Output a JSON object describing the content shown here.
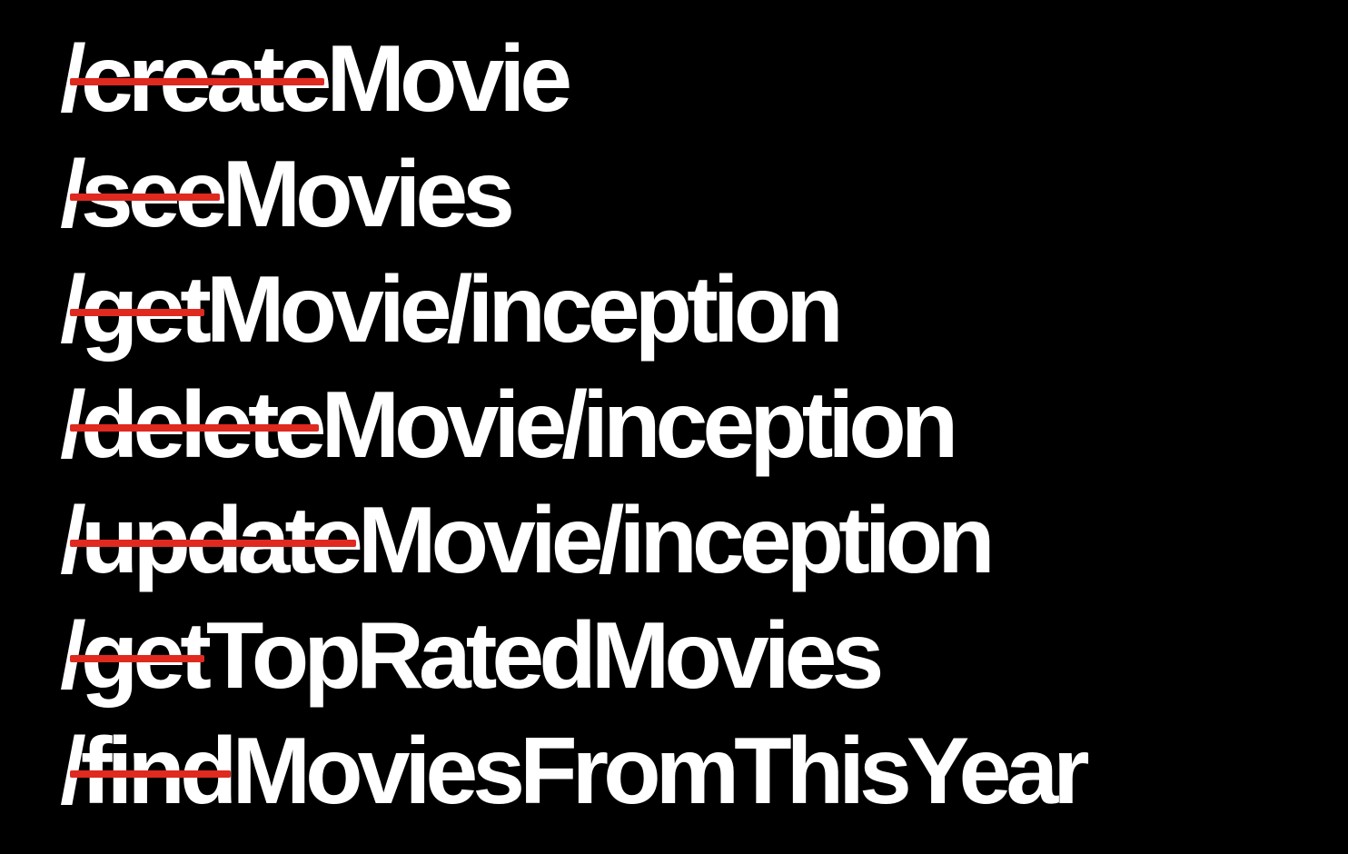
{
  "routes": [
    {
      "slash": "/",
      "verb": "create",
      "resource": "Movie"
    },
    {
      "slash": "/",
      "verb": "see",
      "resource": "Movies"
    },
    {
      "slash": "/",
      "verb": "get",
      "resource": "Movie/inception"
    },
    {
      "slash": "/",
      "verb": "delete",
      "resource": "Movie/inception"
    },
    {
      "slash": "/",
      "verb": "update",
      "resource": "Movie/inception"
    },
    {
      "slash": "/",
      "verb": "get",
      "resource": "TopRatedMovies"
    },
    {
      "slash": "/",
      "verb": "find",
      "resource": "MoviesFromThisYear"
    }
  ],
  "colors": {
    "background": "#000000",
    "text": "#ffffff",
    "strikethrough": "#e0291f"
  }
}
